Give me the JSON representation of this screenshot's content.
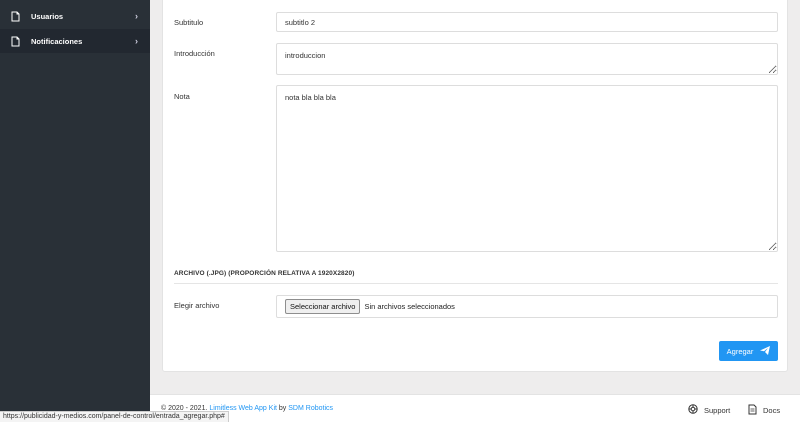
{
  "sidebar": {
    "items": [
      {
        "label": "Usuarios",
        "icon": "document-icon"
      },
      {
        "label": "Notificaciones",
        "icon": "document-icon"
      }
    ]
  },
  "form": {
    "subtitulo": {
      "label": "Subtitulo",
      "value": "subtitlo 2"
    },
    "introduccion": {
      "label": "Introducción",
      "value": "introduccion"
    },
    "nota": {
      "label": "Nota",
      "value": "nota bla bla bla"
    },
    "section_title": "ARCHIVO (.JPG) (PROPORCIÓN RELATIVA A 1920X2820)",
    "archivo": {
      "label": "Elegir archivo",
      "button": "Seleccionar archivo",
      "status": "Sin archivos seleccionados"
    },
    "submit_label": "Agregar"
  },
  "footer": {
    "copyright": "© 2020 - 2021.",
    "kit_link": "Limitless Web App Kit",
    "by": "by",
    "author_link": "SDM Robotics",
    "support": "Support",
    "docs": "Docs"
  },
  "status_bar_url": "https://publicidad-y-medios.com/panel-de-control/entrada_agregar.php#",
  "colors": {
    "sidebar": "#293037",
    "accent": "#2196f3"
  }
}
